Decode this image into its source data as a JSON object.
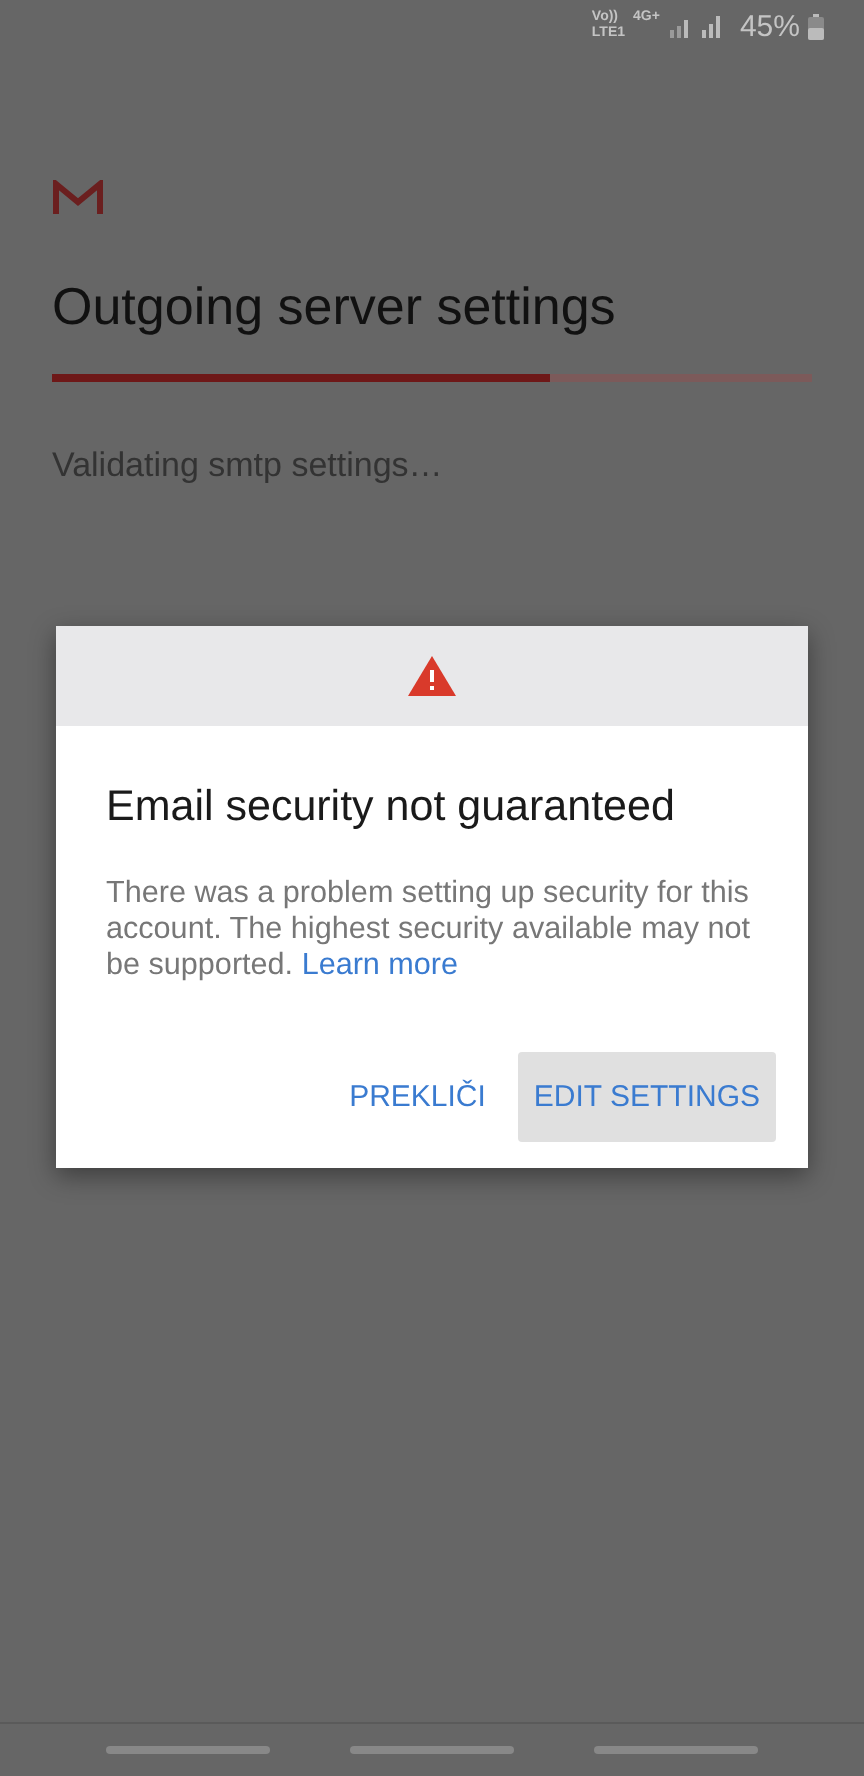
{
  "status_bar": {
    "volte": "Vo))",
    "lte": "LTE1",
    "network": "4G+",
    "battery": "45%"
  },
  "screen": {
    "title": "Outgoing server settings",
    "progress": {
      "level": 0.655
    },
    "status": "Validating smtp settings…"
  },
  "dialog": {
    "title": "Email security not guaranteed",
    "message": "There was a problem setting up security for this account. The highest security available may not be supported.",
    "link": "Learn more",
    "buttons": [
      {
        "label": "PREKLIČI",
        "selected": false
      },
      {
        "label": "EDIT SETTINGS",
        "selected": true
      }
    ]
  }
}
